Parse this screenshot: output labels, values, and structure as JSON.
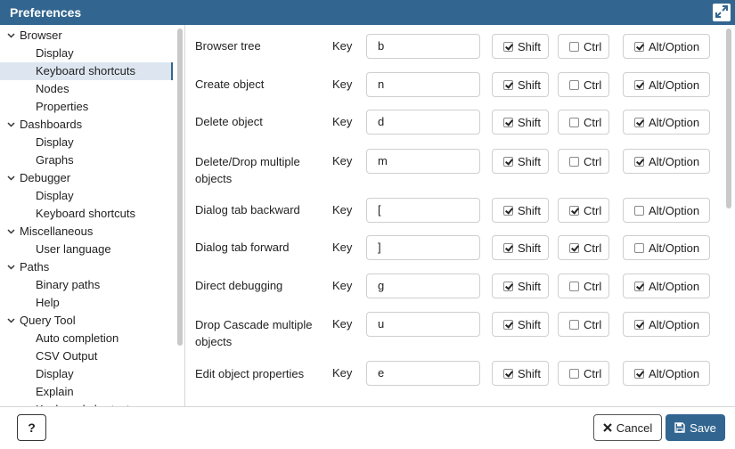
{
  "dialog": {
    "title": "Preferences"
  },
  "sidebar": {
    "items": [
      {
        "label": "Browser",
        "level": 0
      },
      {
        "label": "Display",
        "level": 1
      },
      {
        "label": "Keyboard shortcuts",
        "level": 1,
        "selected": true
      },
      {
        "label": "Nodes",
        "level": 1
      },
      {
        "label": "Properties",
        "level": 1
      },
      {
        "label": "Dashboards",
        "level": 0
      },
      {
        "label": "Display",
        "level": 1
      },
      {
        "label": "Graphs",
        "level": 1
      },
      {
        "label": "Debugger",
        "level": 0
      },
      {
        "label": "Display",
        "level": 1
      },
      {
        "label": "Keyboard shortcuts",
        "level": 1
      },
      {
        "label": "Miscellaneous",
        "level": 0
      },
      {
        "label": "User language",
        "level": 1
      },
      {
        "label": "Paths",
        "level": 0
      },
      {
        "label": "Binary paths",
        "level": 1
      },
      {
        "label": "Help",
        "level": 1
      },
      {
        "label": "Query Tool",
        "level": 0
      },
      {
        "label": "Auto completion",
        "level": 1
      },
      {
        "label": "CSV Output",
        "level": 1
      },
      {
        "label": "Display",
        "level": 1
      },
      {
        "label": "Explain",
        "level": 1
      },
      {
        "label": "Keyboard shortcuts",
        "level": 1
      }
    ]
  },
  "shortcut_labels": {
    "key": "Key",
    "shift": "Shift",
    "ctrl": "Ctrl",
    "alt": "Alt/Option"
  },
  "shortcuts": [
    {
      "name": "Browser tree",
      "key": "b",
      "shift": true,
      "ctrl": false,
      "alt": true
    },
    {
      "name": "Create object",
      "key": "n",
      "shift": true,
      "ctrl": false,
      "alt": true
    },
    {
      "name": "Delete object",
      "key": "d",
      "shift": true,
      "ctrl": false,
      "alt": true
    },
    {
      "name": "Delete/Drop multiple objects",
      "key": "m",
      "shift": true,
      "ctrl": false,
      "alt": true
    },
    {
      "name": "Dialog tab backward",
      "key": "[",
      "shift": true,
      "ctrl": true,
      "alt": false
    },
    {
      "name": "Dialog tab forward",
      "key": "]",
      "shift": true,
      "ctrl": true,
      "alt": false
    },
    {
      "name": "Direct debugging",
      "key": "g",
      "shift": true,
      "ctrl": false,
      "alt": true
    },
    {
      "name": "Drop Cascade multiple objects",
      "key": "u",
      "shift": true,
      "ctrl": false,
      "alt": true
    },
    {
      "name": "Edit object properties",
      "key": "e",
      "shift": true,
      "ctrl": false,
      "alt": true
    }
  ],
  "footer": {
    "help_label": "?",
    "cancel_label": "Cancel",
    "save_label": "Save"
  },
  "colors": {
    "accent": "#326690",
    "selected_bg": "#dde6f0",
    "border": "#cfcfcf"
  },
  "icons": {
    "maximize": "expand-icon",
    "cancel": "close-icon",
    "save": "floppy-disk-icon",
    "caret": "chevron-down-icon"
  }
}
